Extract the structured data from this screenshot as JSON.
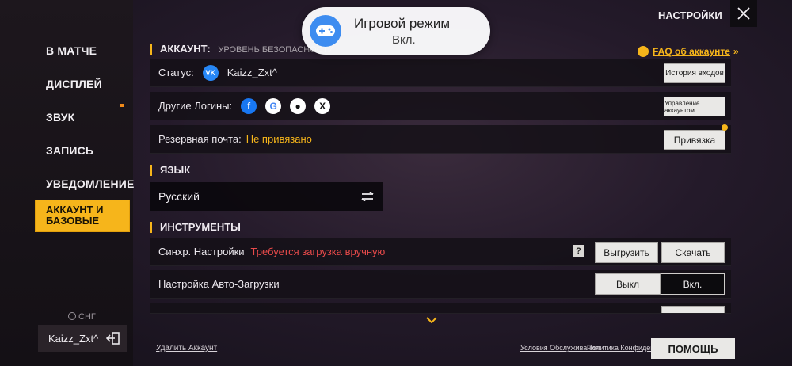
{
  "toast": {
    "title": "Игровой режим",
    "subtitle": "Вкл."
  },
  "header": {
    "title": "НАСТРОЙКИ"
  },
  "sidebar": {
    "items": [
      {
        "label": "В МАТЧЕ"
      },
      {
        "label": "ДИСПЛЕЙ"
      },
      {
        "label": "ЗВУК"
      },
      {
        "label": "ЗАПИСЬ"
      },
      {
        "label": "УВЕДОМЛЕНИЕ"
      },
      {
        "label": "АККАУНТ И БАЗОВЫЕ"
      }
    ],
    "region": "СНГ",
    "username": "Kaizz_Zxt^"
  },
  "account": {
    "section": "АККАУНТ:",
    "security_level": "УРОВЕНЬ БЕЗОПАСНОСТИ",
    "faq": "FAQ об аккаунте",
    "status_label": "Статус:",
    "status_name": "Kaizz_Zxt^",
    "login_history": "История входов",
    "other_logins": "Другие Логины:",
    "manage_account": "Управление аккаунтом",
    "backup_email_label": "Резервная почта:",
    "backup_email_value": "Не привязано",
    "bind": "Привязка"
  },
  "language": {
    "section": "ЯЗЫК",
    "value": "Русский"
  },
  "tools": {
    "section": "ИНСТРУМЕНТЫ",
    "sync_label": "Синхр. Настройки",
    "sync_status": "Требуется загрузка вручную",
    "upload": "Выгрузить",
    "download": "Скачать",
    "autoload_label": "Настройка Авто-Загрузки",
    "off": "Выкл",
    "on": "Вкл."
  },
  "footer": {
    "delete_account": "Удалить Аккаунт",
    "terms": "Условия Обслуживания",
    "privacy": "Политика Конфиденц.",
    "help": "ПОМОЩЬ"
  },
  "colors": {
    "accent": "#f6b51b",
    "warning_red": "#e84a4a",
    "vk_blue": "#2787f5"
  }
}
